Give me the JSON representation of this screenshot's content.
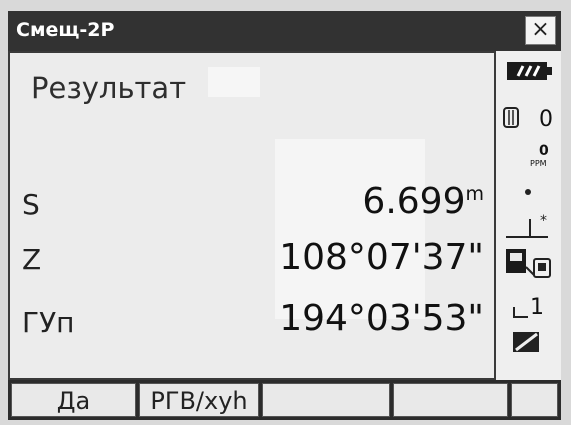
{
  "window": {
    "title": "Смещ-2Р",
    "close_symbol": "×"
  },
  "screen": {
    "heading": "Результат",
    "rows": [
      {
        "label": "S",
        "value": "6.699",
        "unit": "m"
      },
      {
        "label": "Z",
        "value": "108°07'37\""
      },
      {
        "label": "ГУп",
        "value": "194°03'53\""
      }
    ]
  },
  "status": {
    "prism_constant": "0",
    "ppm_value": "0",
    "ppm_label": "PPM",
    "resolution": "1"
  },
  "softkeys": [
    "Да",
    "РГВ/хуh",
    "",
    "",
    ""
  ]
}
